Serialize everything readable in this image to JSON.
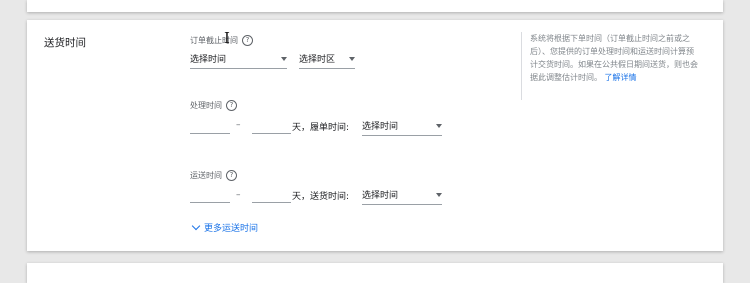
{
  "section": {
    "title": "送货时间"
  },
  "cutoff": {
    "label": "订单截止时间",
    "time_select": "选择时间",
    "timezone_select": "选择时区"
  },
  "handling": {
    "label": "处理时间",
    "day_unit": "天，履单时间:",
    "time_select": "选择时间"
  },
  "transit": {
    "label": "运送时间",
    "day_unit": "天，送货时间:",
    "time_select": "选择时间"
  },
  "more_link": "更多运送时间",
  "help": {
    "text": "系统将根据下单时间（订单截止时间之前或之后）、您提供的订单处理时间和运送时间计算预计交货时间。如果在公共假日期间送货，则也会据此调整估计时间。",
    "link": "了解详情"
  },
  "dash": "–",
  "icons": {
    "help": "question-circle-icon",
    "dropdown": "caret-down-icon",
    "expand": "chevron-down-icon",
    "cursor": "text-cursor-icon"
  },
  "colors": {
    "link": "#1a73e8",
    "background": "#e8e8e8",
    "card": "#ffffff"
  }
}
